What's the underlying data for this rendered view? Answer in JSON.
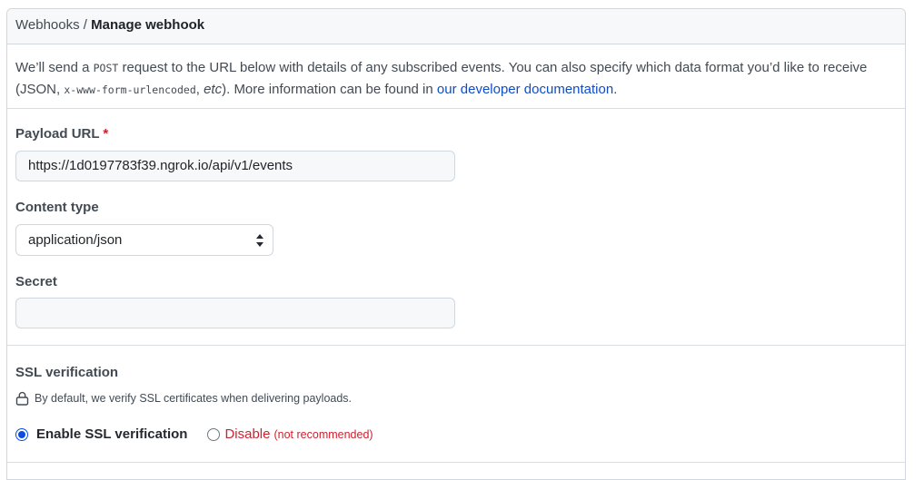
{
  "breadcrumb": {
    "parent": "Webhooks",
    "separator": "/",
    "current": "Manage webhook"
  },
  "intro": {
    "text1": "We’ll send a ",
    "method": "POST",
    "text2": " request to the URL below with details of any subscribed events. You can also specify which data format you’d like to receive (JSON, ",
    "format": "x-www-form-urlencoded",
    "text3": ", ",
    "etc": "etc",
    "text4": "). More information can be found in ",
    "link": "our developer documentation",
    "text5": "."
  },
  "payload_url": {
    "label": "Payload URL",
    "required_marker": "*",
    "value": "https://1d0197783f39.ngrok.io/api/v1/events"
  },
  "content_type": {
    "label": "Content type",
    "selected": "application/json"
  },
  "secret": {
    "label": "Secret",
    "value": ""
  },
  "ssl": {
    "title": "SSL verification",
    "note": "By default, we verify SSL certificates when delivering payloads.",
    "enable_label": "Enable SSL verification",
    "disable_label": "Disable",
    "not_recommended": "(not recommended)",
    "selected": "enable"
  },
  "icons": {
    "lock": "lock-icon",
    "select_caret": "select-caret-icon"
  },
  "colors": {
    "link": "#0f4cc9",
    "required": "#cf222e",
    "radio_accent": "#0b4de0"
  }
}
